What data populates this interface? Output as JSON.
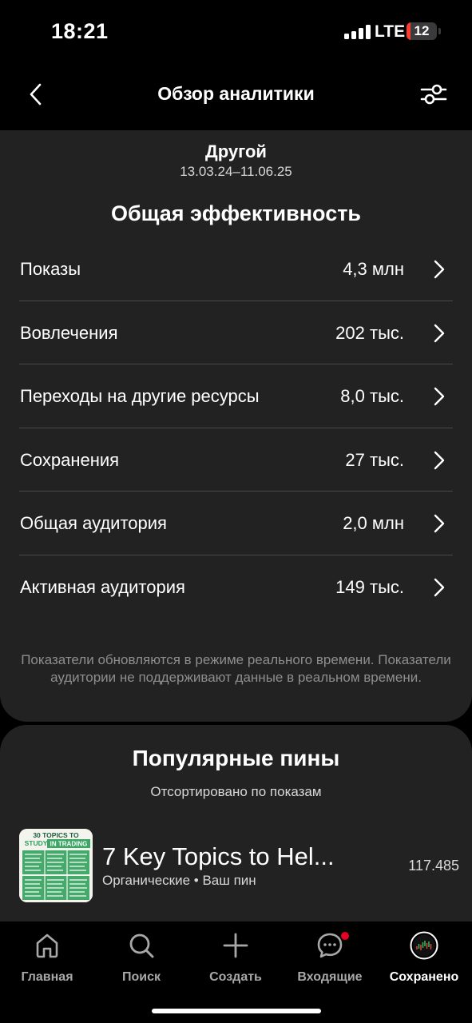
{
  "status_bar": {
    "time": "18:21",
    "network": "LTE",
    "battery": "12",
    "battery_level": 0.12
  },
  "header": {
    "title": "Обзор аналитики",
    "back_icon": "chevron-left-icon",
    "filter_icon": "sliders-icon"
  },
  "overview": {
    "source": "Другой",
    "date_range": "13.03.24–11.06.25",
    "section_title": "Общая эффективность",
    "metrics": [
      {
        "label": "Показы",
        "value": "4,3 млн"
      },
      {
        "label": "Вовлечения",
        "value": "202 тыс."
      },
      {
        "label": "Переходы на другие ресурсы",
        "value": "8,0 тыс."
      },
      {
        "label": "Сохранения",
        "value": "27 тыс."
      },
      {
        "label": "Общая аудитория",
        "value": "2,0 млн"
      },
      {
        "label": "Активная аудитория",
        "value": "149 тыс."
      }
    ],
    "disclaimer": "Показатели обновляются в режиме реального времени. Показатели аудитории не поддерживают данные в реальном времени."
  },
  "popular_pins": {
    "title": "Популярные пины",
    "subtitle": "Отсортировано по показам",
    "items": [
      {
        "title": "7 Key Topics to Hel...",
        "meta": "Органические • Ваш пин",
        "value": "117.485",
        "thumb_line1": "30 TOPICS TO",
        "thumb_line2a": "STUDY",
        "thumb_line2b": "IN TRADING"
      }
    ]
  },
  "tabbar": {
    "accent": "#e60023",
    "tabs": [
      {
        "label": "Главная",
        "icon": "home-icon"
      },
      {
        "label": "Поиск",
        "icon": "search-icon"
      },
      {
        "label": "Создать",
        "icon": "plus-icon"
      },
      {
        "label": "Входящие",
        "icon": "message-icon"
      },
      {
        "label": "Сохранено",
        "icon": "profile-icon"
      }
    ]
  }
}
